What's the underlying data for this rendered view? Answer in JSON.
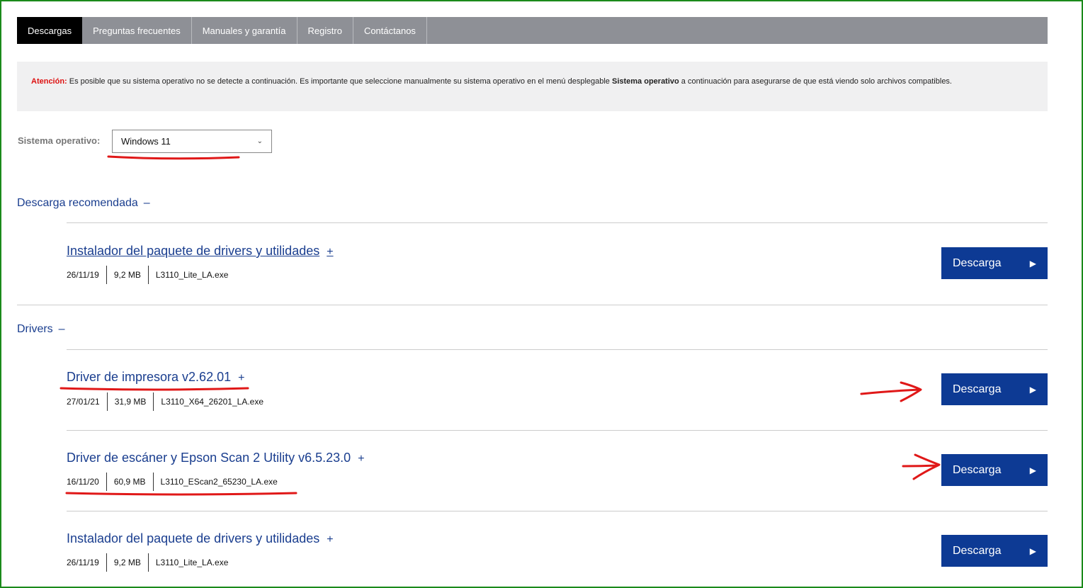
{
  "tabs": [
    {
      "label": "Descargas",
      "active": true
    },
    {
      "label": "Preguntas frecuentes"
    },
    {
      "label": "Manuales y garantía"
    },
    {
      "label": "Registro"
    },
    {
      "label": "Contáctanos"
    }
  ],
  "notice": {
    "warning_label": "Atención:",
    "text_before": " Es posible que su sistema operativo no se detecte a continuación. Es importante que seleccione manualmente su sistema operativo en el menú desplegable ",
    "bold": "Sistema operativo",
    "text_after": " a continuación para asegurarse de que está viendo solo archivos compatibles."
  },
  "os": {
    "label": "Sistema operativo:",
    "selected": "Windows 11"
  },
  "sections": {
    "recommended": {
      "title": "Descarga recomendada",
      "toggle": "–",
      "items": [
        {
          "title": "Instalador del paquete de drivers y utilidades",
          "plus": "+",
          "date": "26/11/19",
          "size": "9,2 MB",
          "file": "L3110_Lite_LA.exe",
          "button": "Descarga"
        }
      ]
    },
    "drivers": {
      "title": "Drivers",
      "toggle": "–",
      "items": [
        {
          "title": "Driver de impresora v2.62.01",
          "plus": "+",
          "date": "27/01/21",
          "size": "31,9 MB",
          "file": "L3110_X64_26201_LA.exe",
          "button": "Descarga"
        },
        {
          "title": "Driver de escáner y Epson Scan 2 Utility v6.5.23.0",
          "plus": "+",
          "date": "16/11/20",
          "size": "60,9 MB",
          "file": "L3110_EScan2_65230_LA.exe",
          "button": "Descarga"
        },
        {
          "title": "Instalador del paquete de drivers y utilidades",
          "plus": "+",
          "date": "26/11/19",
          "size": "9,2 MB",
          "file": "L3110_Lite_LA.exe",
          "button": "Descarga"
        }
      ]
    }
  },
  "icons": {
    "arrow": "play-triangle-icon",
    "chevron": "chevron-down-icon"
  },
  "colors": {
    "tab_bar": "#8e9096",
    "active_tab": "#000000",
    "link": "#1a3e8f",
    "button": "#0d3a94",
    "warning": "#dd1111",
    "annotation": "#e01818",
    "frame": "#1a8a1a"
  }
}
